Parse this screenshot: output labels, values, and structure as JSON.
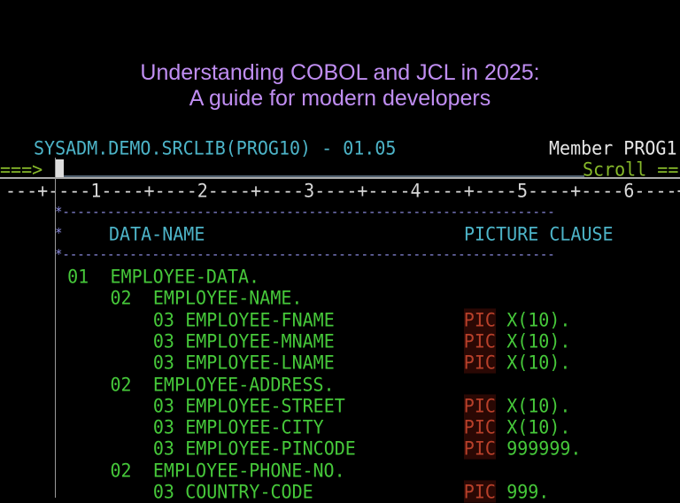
{
  "overlay_title": {
    "line1": "Understanding COBOL and JCL in 2025:",
    "line2": "A guide for modern developers"
  },
  "header": {
    "dataset": "SYSADM.DEMO.SRCLIB(PROG10) - 01.05",
    "member": "Member PROG1"
  },
  "command": {
    "prompt": "===>",
    "value": "",
    "scroll": "Scroll =="
  },
  "ruler": "---+----1----+----2----+----3----+----4----+----5----+----6----+",
  "comments": {
    "dashes": "*------------------------------------------------------------------",
    "star": "*",
    "data_name": "DATA-NAME",
    "picture_clause": "PICTURE CLAUSE"
  },
  "code_lines": [
    {
      "level": "01",
      "name": "EMPLOYEE-DATA.",
      "pic": "",
      "pic_value": ""
    },
    {
      "level": "02",
      "name": "EMPLOYEE-NAME.",
      "pic": "",
      "pic_value": ""
    },
    {
      "level": "03",
      "name": "EMPLOYEE-FNAME",
      "pic": "PIC",
      "pic_value": "X(10)."
    },
    {
      "level": "03",
      "name": "EMPLOYEE-MNAME",
      "pic": "PIC",
      "pic_value": "X(10)."
    },
    {
      "level": "03",
      "name": "EMPLOYEE-LNAME",
      "pic": "PIC",
      "pic_value": "X(10)."
    },
    {
      "level": "02",
      "name": "EMPLOYEE-ADDRESS.",
      "pic": "",
      "pic_value": ""
    },
    {
      "level": "03",
      "name": "EMPLOYEE-STREET",
      "pic": "PIC",
      "pic_value": "X(10)."
    },
    {
      "level": "03",
      "name": "EMPLOYEE-CITY",
      "pic": "PIC",
      "pic_value": "X(10)."
    },
    {
      "level": "03",
      "name": "EMPLOYEE-PINCODE",
      "pic": "PIC",
      "pic_value": "999999."
    },
    {
      "level": "02",
      "name": "EMPLOYEE-PHONE-NO.",
      "pic": "",
      "pic_value": ""
    },
    {
      "level": "03",
      "name": "COUNTRY-CODE",
      "pic": "PIC",
      "pic_value": "999."
    }
  ],
  "colors": {
    "title": "#c08ef2",
    "header": "#4db4c8",
    "code": "#46c83a",
    "pic": "#b8402a",
    "comment": "#8c8ce0"
  }
}
